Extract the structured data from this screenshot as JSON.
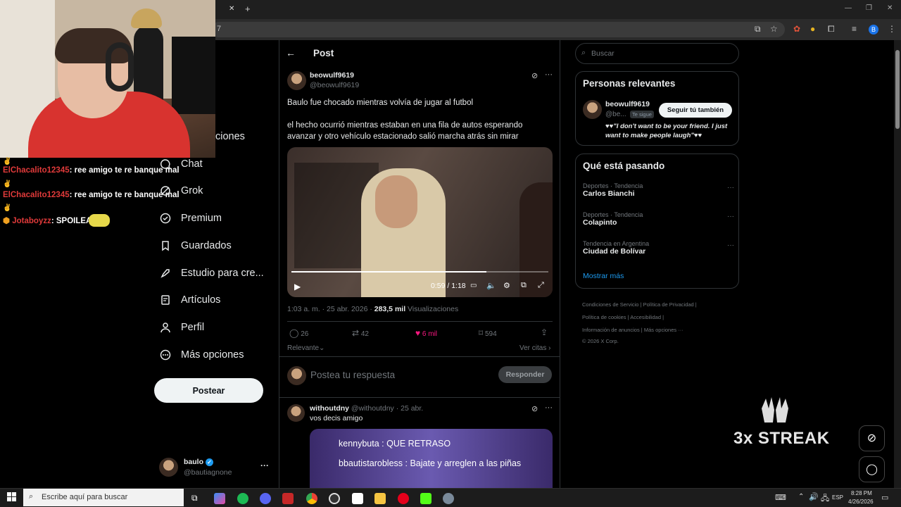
{
  "browser": {
    "tab_close": "✕",
    "new_tab": "+",
    "url_fragment": "7",
    "window_controls": [
      "—",
      "❐",
      "✕"
    ],
    "profile_initial": "B"
  },
  "chat": {
    "lines": [
      {
        "user": "ElChacalito12345",
        "message": ": ree amigo te re banque mal"
      },
      {
        "user": "ElChacalito12345",
        "message": ": ree amigo te re banque mal"
      },
      {
        "user": "Jotaboyzz",
        "message": ": SPOILEA"
      }
    ]
  },
  "nav": {
    "partial_label": "ciones",
    "items": [
      {
        "label": "Chat",
        "icon": "chat-icon"
      },
      {
        "label": "Grok",
        "icon": "grok-icon"
      },
      {
        "label": "Premium",
        "icon": "premium-icon"
      },
      {
        "label": "Guardados",
        "icon": "bookmark-icon"
      },
      {
        "label": "Estudio para cre...",
        "icon": "rocket-icon"
      },
      {
        "label": "Artículos",
        "icon": "article-icon"
      },
      {
        "label": "Perfil",
        "icon": "profile-icon"
      },
      {
        "label": "Más opciones",
        "icon": "more-circle-icon"
      }
    ],
    "post_button": "Postear",
    "account": {
      "name": "baulo",
      "handle": "@bautiagnone",
      "more": "···"
    }
  },
  "post": {
    "header": "Post",
    "author_name": "beowulf9619",
    "author_handle": "@beowulf9619",
    "text1": "Baulo fue chocado mientras volvía de jugar al futbol",
    "text2": "el hecho ocurrió mientras estaban en una fila de autos esperando avanzar y otro vehículo estacionado salió marcha atrás sin mirar",
    "video": {
      "time": "0:59 / 1:18",
      "progress": 0.76
    },
    "timestamp": "1:03 a. m. · 25 abr. 2026 · ",
    "views_count": "283,5 mil",
    "views_label": " Visualizaciones",
    "stats": {
      "replies": "26",
      "reposts": "42",
      "likes": "6 mil",
      "bookmarks": "594"
    },
    "sort_label": "Relevante",
    "quotes_label": "Ver citas",
    "reply_placeholder": "Postea tu respuesta",
    "reply_button": "Responder"
  },
  "reply": {
    "author_name": "withoutdny",
    "author_handle": "@withoutdny",
    "date": " · 25 abr.",
    "text": "vos decis amigo",
    "image_lines": [
      {
        "user": "kennybuta",
        "msg": " : QUE RETRASO"
      },
      {
        "user": "bbautistarobless",
        "msg": " : Bajate y arreglen a las piñas"
      }
    ]
  },
  "sidebar": {
    "search_placeholder": "Buscar",
    "relevant": {
      "title": "Personas relevantes",
      "name": "beowulf9619",
      "handle": "@be...",
      "follows_you": "Te sigue",
      "follow_button": "Seguir tú también",
      "bio": "♥♥\"I don't want to be your friend. I just want to make people laugh\"♥♥"
    },
    "trends": {
      "title": "Qué está pasando",
      "items": [
        {
          "category": "Deportes · Tendencia",
          "name": "Carlos Bianchi"
        },
        {
          "category": "Deportes · Tendencia",
          "name": "Colapinto"
        },
        {
          "category": "Tendencia en Argentina",
          "name": "Ciudad de Bolívar"
        }
      ],
      "show_more": "Mostrar más"
    },
    "footer": [
      "Condiciones de Servicio",
      "Política de Privacidad",
      "Política de cookies",
      "Accesibilidad",
      "Información de anuncios",
      "Más opciones ···",
      "© 2026 X Corp."
    ]
  },
  "overlay": {
    "streak": "3x STREAK"
  },
  "taskbar": {
    "search_placeholder": "Escribe aquí para buscar",
    "language": "ESP",
    "time": "8:28 PM",
    "date": "4/26/2026"
  },
  "colors": {
    "like": "#f91880",
    "accent": "#1d9bf0",
    "background": "#000000"
  }
}
